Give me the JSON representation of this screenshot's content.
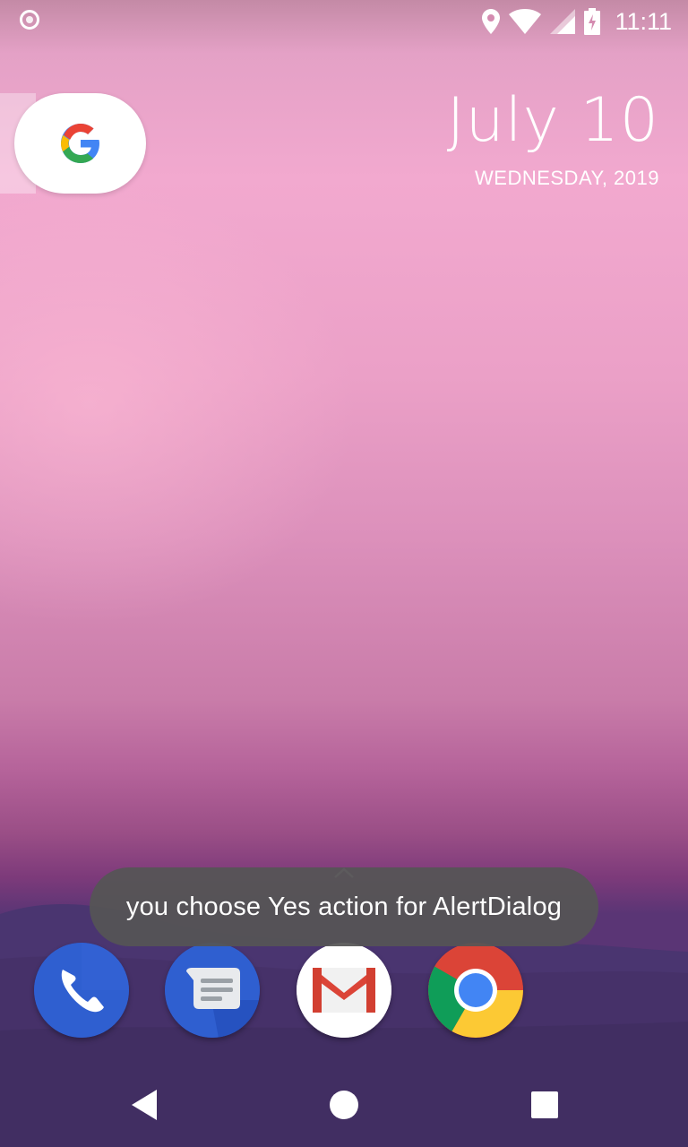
{
  "status_bar": {
    "time": "11:11",
    "icons": [
      "notification-dot-icon",
      "location-icon",
      "wifi-icon",
      "signal-icon",
      "battery-charging-icon"
    ]
  },
  "search_widget": {
    "icon": "google-g-icon"
  },
  "date_widget": {
    "date": "July 10",
    "weekday_year": "WEDNESDAY, 2019"
  },
  "toast": {
    "message": "you choose Yes action for AlertDialog"
  },
  "dock": {
    "apps": [
      {
        "name": "Phone",
        "icon": "phone-icon",
        "color": "#2a56c6"
      },
      {
        "name": "Messages",
        "icon": "messages-icon",
        "color": "#2a56c6"
      },
      {
        "name": "Gmail",
        "icon": "gmail-icon",
        "color": "#ffffff"
      },
      {
        "name": "Chrome",
        "icon": "chrome-icon",
        "color": "#db4437"
      }
    ]
  },
  "nav_bar": {
    "buttons": [
      "back-icon",
      "home-icon",
      "recents-icon"
    ]
  }
}
